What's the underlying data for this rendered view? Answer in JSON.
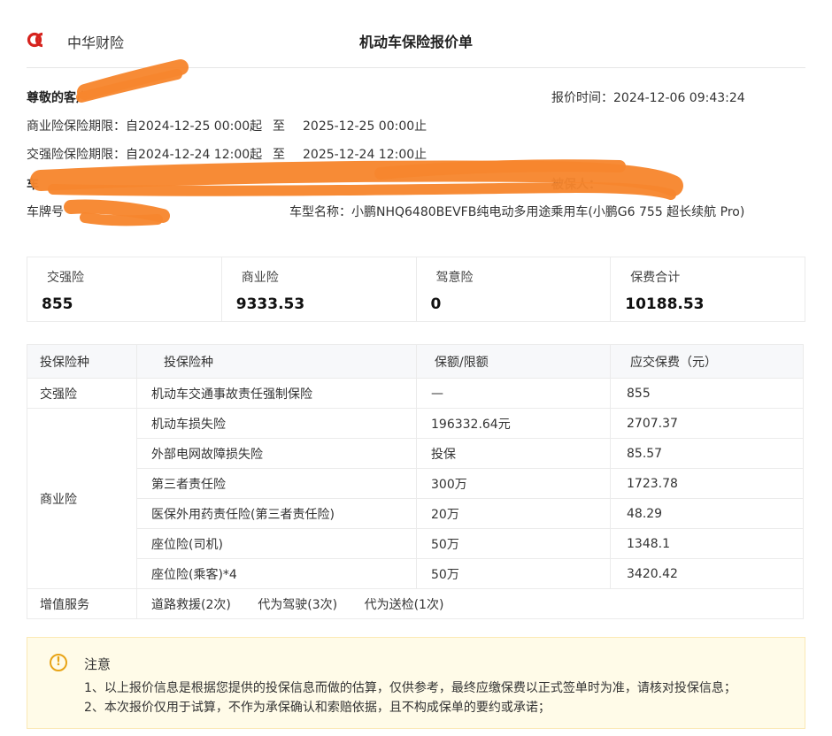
{
  "header": {
    "brand": "中华财险",
    "title": "机动车保险报价单"
  },
  "info": {
    "greeting": "尊敬的客户",
    "quote_time": "报价时间：2024-12-06 09:43:24",
    "commercial_period_label": "商业险保险期限：自2024-12-25 00:00起",
    "commercial_to": "至",
    "commercial_end": "2025-12-25 00:00止",
    "compulsory_period_label": "交强险保险期限：自2024-12-24 12:00起",
    "compulsory_to": "至",
    "compulsory_end": "2025-12-24 12:00止",
    "owner_label": "车",
    "insured_label": "被保人：",
    "plate_label": "车牌号",
    "model": "车型名称：小鹏NHQ6480BEVFB纯电动多用途乘用车(小鹏G6 755 超长续航 Pro)"
  },
  "summary": [
    {
      "label": "交强险",
      "value": "855"
    },
    {
      "label": "商业险",
      "value": "9333.53"
    },
    {
      "label": "驾意险",
      "value": "0"
    },
    {
      "label": "保费合计",
      "value": "10188.53"
    }
  ],
  "table": {
    "headers": [
      "投保险种",
      "投保险种",
      "保额/限额",
      "应交保费（元）"
    ],
    "compulsory": {
      "category": "交强险",
      "name": "机动车交通事故责任强制保险",
      "coverage": "—",
      "premium": "855"
    },
    "commercial_category": "商业险",
    "commercial_rows": [
      {
        "name": "机动车损失险",
        "coverage": "196332.64元",
        "premium": "2707.37"
      },
      {
        "name": "外部电网故障损失险",
        "coverage": "投保",
        "premium": "85.57"
      },
      {
        "name": "第三者责任险",
        "coverage": "300万",
        "premium": "1723.78"
      },
      {
        "name": "医保外用药责任险(第三者责任险)",
        "coverage": "20万",
        "premium": "48.29"
      },
      {
        "name": "座位险(司机)",
        "coverage": "50万",
        "premium": "1348.1"
      },
      {
        "name": "座位险(乘客)*4",
        "coverage": "50万",
        "premium": "3420.42"
      }
    ],
    "value_added": {
      "category": "增值服务",
      "services": [
        "道路救援(2次)",
        "代为驾驶(3次)",
        "代为送检(1次)"
      ]
    }
  },
  "notice": {
    "icon": "!",
    "title": "注意",
    "lines": [
      "1、以上报价信息是根据您提供的投保信息而做的估算，仅供参考，最终应缴保费以正式签单时为准，请核对投保信息；",
      "2、本次报价仅用于试算，不作为承保确认和索赔依据，且不构成保单的要约或承诺；"
    ]
  },
  "colors": {
    "brand_red": "#d6231e",
    "redaction_orange": "#f7862e",
    "notice_bg": "#fffbe8",
    "warning_icon": "#e8a417"
  }
}
